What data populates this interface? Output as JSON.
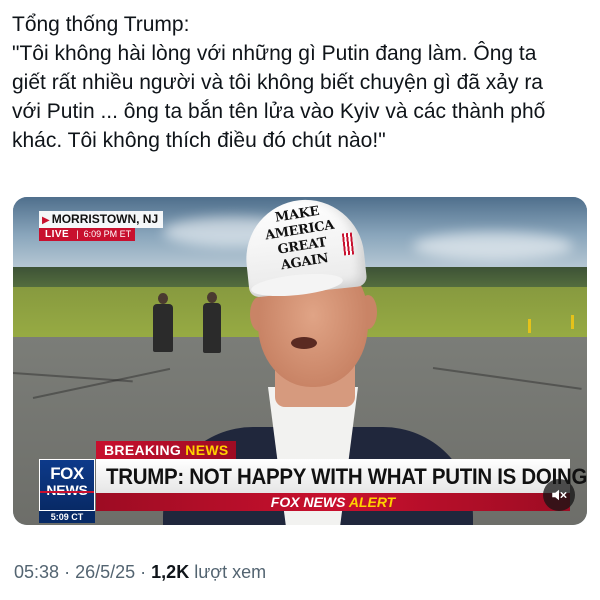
{
  "post": {
    "text_lines": [
      "Tổng thống Trump:",
      "\"Tôi không hài lòng với những gì Putin đang làm. Ông ta",
      "giết rất nhiều người và tôi không biết chuyện gì đã xảy ra",
      "với Putin ... ông ta bắn tên lửa vào Kyiv và các thành phố",
      "khác. Tôi không thích điều đó chút nào!\""
    ]
  },
  "media": {
    "location": "MORRISTOWN, NJ",
    "live_label": "LIVE",
    "live_separator": "|",
    "live_time": "6:09 PM ET",
    "cap_text_line1": "MAKE AMERICA",
    "cap_text_line2": "GREAT AGAIN",
    "breaking_word1": "BREAKING",
    "breaking_word2": "NEWS",
    "headline": "TRUMP: NOT HAPPY WITH WHAT PUTIN IS DOING",
    "alert_word1": "FOX NEWS",
    "alert_word2": "ALERT",
    "logo_line1": "FOX",
    "logo_line2": "NEWS",
    "logo_time": "5:09 CT",
    "mute_icon": "speaker-muted-icon"
  },
  "meta": {
    "time": "05:38",
    "separator1": "·",
    "date": "26/5/25",
    "separator2": "·",
    "views_count": "1,2K",
    "views_label": "lượt xem"
  }
}
